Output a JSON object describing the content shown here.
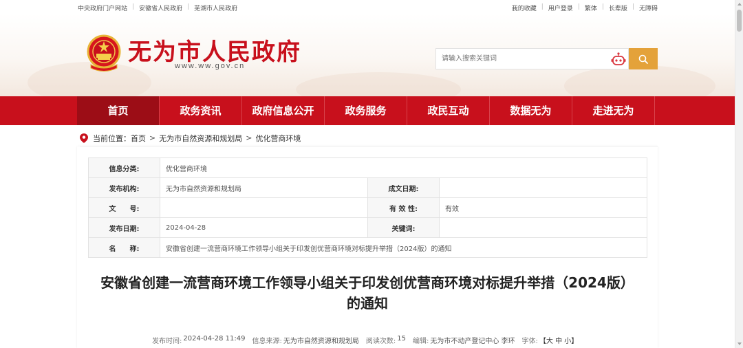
{
  "topbar": {
    "left_links": [
      "中央政府门户网站",
      "安徽省人民政府",
      "芜湖市人民政府"
    ],
    "right_links": [
      "我的收藏",
      "用户登录",
      "繁体",
      "长辈版",
      "无障碍"
    ]
  },
  "header": {
    "site_title": "无为市人民政府",
    "site_domain": "www.ww.gov.cn",
    "search_placeholder": "请输入搜索关键词",
    "emblem_icon": "national-emblem-icon",
    "robot_icon": "robot-assistant-icon",
    "search_icon": "search-icon"
  },
  "nav": {
    "items": [
      "首页",
      "政务资讯",
      "政府信息公开",
      "政务服务",
      "政民互动",
      "数据无为",
      "走进无为"
    ],
    "active_index": 0
  },
  "breadcrumb": {
    "label": "当前位置：",
    "items": [
      "首页",
      "无为市自然资源和规划局",
      "优化营商环境"
    ],
    "separator": ">"
  },
  "info": {
    "category_label": "信息分类:",
    "category_value": "优化营商环境",
    "publisher_label": "发布机构:",
    "publisher_value": "无为市自然资源和规划局",
    "created_label": "成文日期:",
    "created_value": "",
    "doc_no_label": "文　　号:",
    "doc_no_value": "",
    "validity_label": "有 效 性:",
    "validity_value": "有效",
    "publish_date_label": "发布日期:",
    "publish_date_value": "2024-04-28",
    "keywords_label": "关键词:",
    "keywords_value": "",
    "name_label": "名　　称:",
    "name_value": "安徽省创建一流营商环境工作领导小组关于印发创优营商环境对标提升举措（2024版）的通知"
  },
  "article": {
    "title": "安徽省创建一流营商环境工作领导小组关于印发创优营商环境对标提升举措（2024版）的通知",
    "meta": {
      "publish_time_label": "发布时间:",
      "publish_time": "2024-04-28 11:49",
      "source_label": "信息来源:",
      "source": "无为市自然资源和规划局",
      "views_label": "阅读次数:",
      "views": "15",
      "editor_label": "编辑:",
      "editor": "无为市不动产登记中心 李环",
      "font_label": "字体:",
      "font_options": "【大 中 小】"
    }
  },
  "colors": {
    "brand_red": "#c8101c",
    "nav_active": "#9c0d16",
    "search_button": "#e4a23a"
  }
}
